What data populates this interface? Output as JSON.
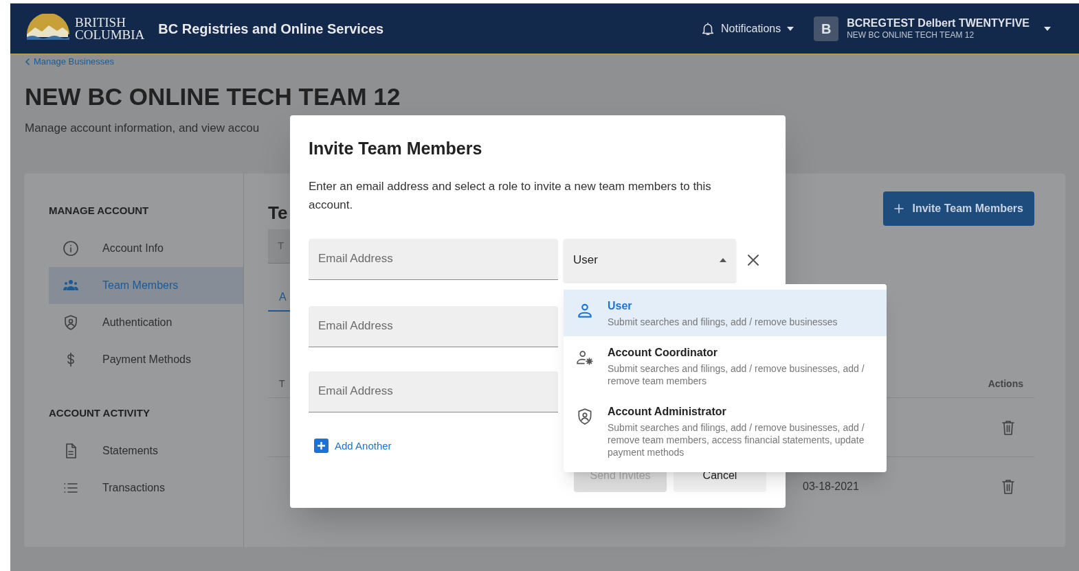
{
  "header": {
    "logo_lines": [
      "BRITISH",
      "COLUMBIA"
    ],
    "title": "BC Registries and Online Services",
    "notifications": "Notifications",
    "user": {
      "initial": "B",
      "name": "BCREGTEST Delbert TWENTYFIVE",
      "account": "NEW BC ONLINE TECH TEAM 12"
    }
  },
  "breadcrumb": "Manage Businesses",
  "page": {
    "title": "NEW BC ONLINE TECH TEAM 12",
    "subtitle": "Manage account information, and view accou"
  },
  "sidebar": {
    "sections": [
      {
        "heading": "MANAGE ACCOUNT",
        "items": [
          {
            "label": "Account Info",
            "selected": false
          },
          {
            "label": "Team Members",
            "selected": true
          },
          {
            "label": "Authentication",
            "selected": false
          },
          {
            "label": "Payment Methods",
            "selected": false
          }
        ]
      },
      {
        "heading": "ACCOUNT ACTIVITY",
        "items": [
          {
            "label": "Statements",
            "selected": false
          },
          {
            "label": "Transactions",
            "selected": false
          }
        ]
      }
    ]
  },
  "content": {
    "heading": "Te",
    "search_placeholder": "T",
    "tab": "A",
    "column_1": "T",
    "invite_button": "Invite Team Members",
    "actions_header": "Actions",
    "rows": [
      {
        "kind": "member"
      },
      {
        "kind": "member",
        "date": "03-18-2021"
      }
    ]
  },
  "dialog": {
    "title": "Invite Team Members",
    "description": "Enter an email address and select a role to invite a new team members to this account.",
    "email_fields": [
      {
        "placeholder": "Email Address"
      },
      {
        "placeholder": "Email Address"
      },
      {
        "placeholder": "Email Address"
      }
    ],
    "role_select": {
      "value": "User",
      "expanded": true
    },
    "add_another": "Add Another",
    "buttons": [
      {
        "label": "Send Invites",
        "disabled": true
      },
      {
        "label": "Cancel",
        "disabled": false
      }
    ],
    "role_options": [
      {
        "name": "User",
        "description": "Submit searches and filings, add / remove businesses",
        "selected": true
      },
      {
        "name": "Account Coordinator",
        "description": "Submit searches and filings, add / remove businesses, add / remove team members",
        "selected": false
      },
      {
        "name": "Account Administrator",
        "description": "Submit searches and filings, add / remove businesses, add / remove team members, access financial statements, update payment methods",
        "selected": false
      }
    ]
  }
}
